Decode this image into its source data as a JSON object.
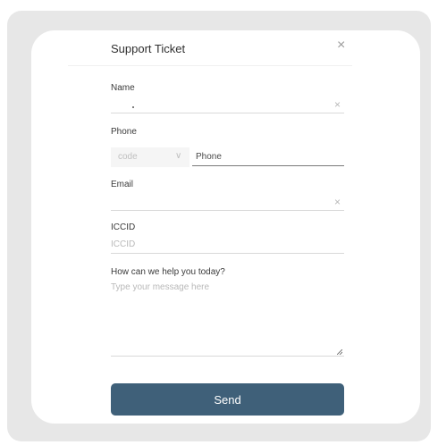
{
  "dialog": {
    "title": "Support Ticket",
    "close_icon": "close-icon"
  },
  "form": {
    "name": {
      "label": "Name",
      "value": ""
    },
    "phone": {
      "label": "Phone",
      "code_placeholder": "code",
      "placeholder": "Phone"
    },
    "email": {
      "label": "Email",
      "value": ""
    },
    "iccid": {
      "label": "ICCID",
      "placeholder": "ICCID"
    },
    "message": {
      "label": "How can we help you today?",
      "placeholder": "Type your message here"
    },
    "send_label": "Send"
  },
  "colors": {
    "accent": "#3f6079",
    "background": "#e7e7e7"
  }
}
